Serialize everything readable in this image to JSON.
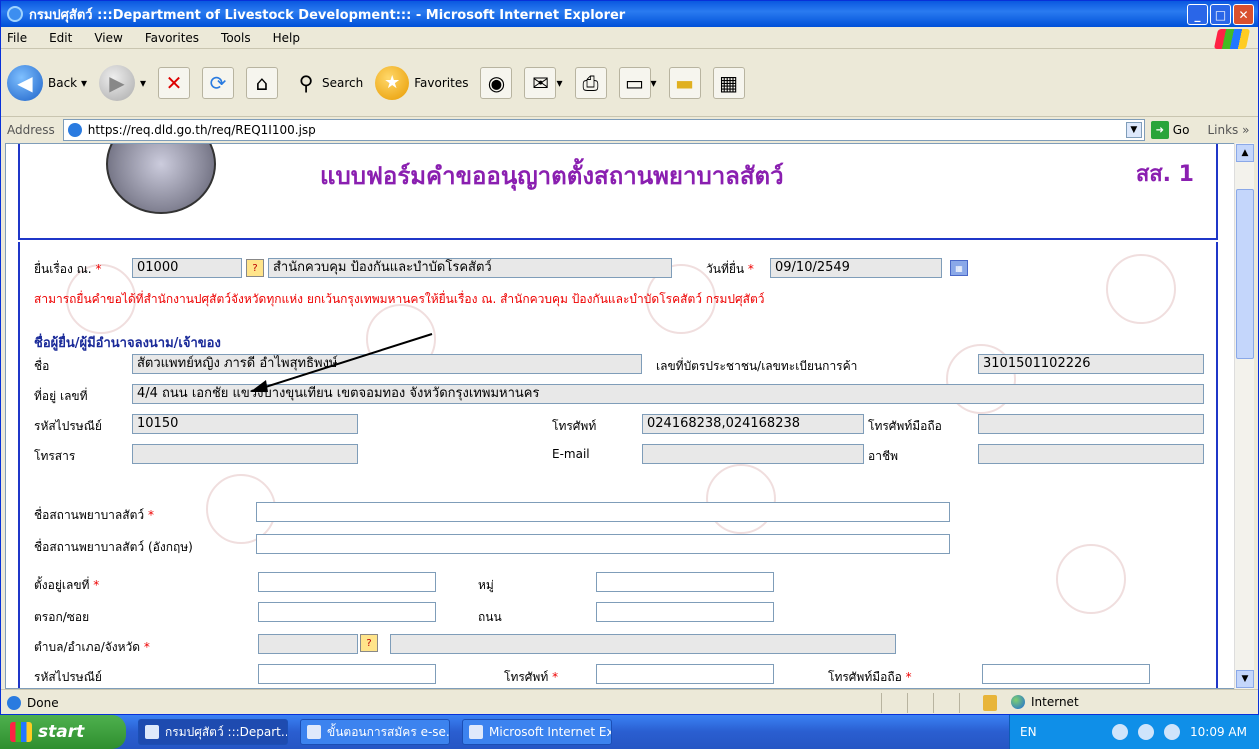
{
  "window": {
    "title": "กรมปศุสัตว์ :::Department of Livestock Development::: - Microsoft Internet Explorer"
  },
  "menu": [
    "File",
    "Edit",
    "View",
    "Favorites",
    "Tools",
    "Help"
  ],
  "toolbar": {
    "back": "Back",
    "search": "Search",
    "favorites": "Favorites"
  },
  "address": {
    "label": "Address",
    "url": "https://req.dld.go.th/req/REQ1I100.jsp",
    "go": "Go",
    "links": "Links"
  },
  "page": {
    "title": "แบบฟอร์มคำขออนุญาตตั้งสถานพยาบาลสัตว์",
    "code": "สส. 1",
    "filed_at_label": "ยื่นเรื่อง ณ.",
    "filed_at_code": "01000",
    "filed_at_name": "สำนักควบคุม ป้องกันและบำบัดโรคสัตว์",
    "date_label": "วันที่ยื่น",
    "date_value": "09/10/2549",
    "note": "สามารถยื่นคำขอได้ที่สำนักงานปศุสัตว์จังหวัดทุกแห่ง ยกเว้นกรุงเทพมหานครให้ยื่นเรื่อง ณ. สำนักควบคุม ป้องกันและบำบัดโรคสัตว์ กรมปศุสัตว์",
    "section": "ชื่อผู้ยื่น/ผู้มีอำนาจลงนาม/เจ้าของ",
    "name_label": "ชื่อ",
    "name_value": "สัตวแพทย์หญิง ภารดี อำไพสุทธิพงษ์",
    "idcard_label": "เลขที่บัตรประชาชน/เลขทะเบียนการค้า",
    "idcard_value": "3101501102226",
    "addr_label": "ที่อยู่ เลขที่",
    "addr_value": "4/4 ถนน เอกชัย แขวงบางขุนเทียน เขตจอมทอง จังหวัดกรุงเทพมหานคร",
    "postal_label": "รหัสไปรษณีย์",
    "postal_value": "10150",
    "phone_label": "โทรศัพท์",
    "phone_value": "024168238,024168238",
    "mobile_label": "โทรศัพท์มือถือ",
    "fax_label": "โทรสาร",
    "email_label": "E-mail",
    "occupation_label": "อาชีพ",
    "clinic_name_label": "ชื่อสถานพยาบาลสัตว์",
    "clinic_name_en_label": "ชื่อสถานพยาบาลสัตว์ (อังกฤษ)",
    "located_label": "ตั้งอยู่เลขที่",
    "moo_label": "หมู่",
    "soi_label": "ตรอก/ซอย",
    "road_label": "ถนน",
    "district_label": "ตำบล/อำเภอ/จังหวัด",
    "postal2_label": "รหัสไปรษณีย์",
    "phone2_label": "โทรศัพท์",
    "mobile2_label": "โทรศัพท์มือถือ",
    "required_mark": "*"
  },
  "status": {
    "text": "Done",
    "zone": "Internet"
  },
  "taskbar": {
    "start": "start",
    "tasks": [
      "กรมปศุสัตว์ :::Depart...",
      "ขั้นตอนการสมัคร e-se...",
      "Microsoft Internet Ex..."
    ],
    "lang": "EN",
    "time": "10:09 AM"
  }
}
